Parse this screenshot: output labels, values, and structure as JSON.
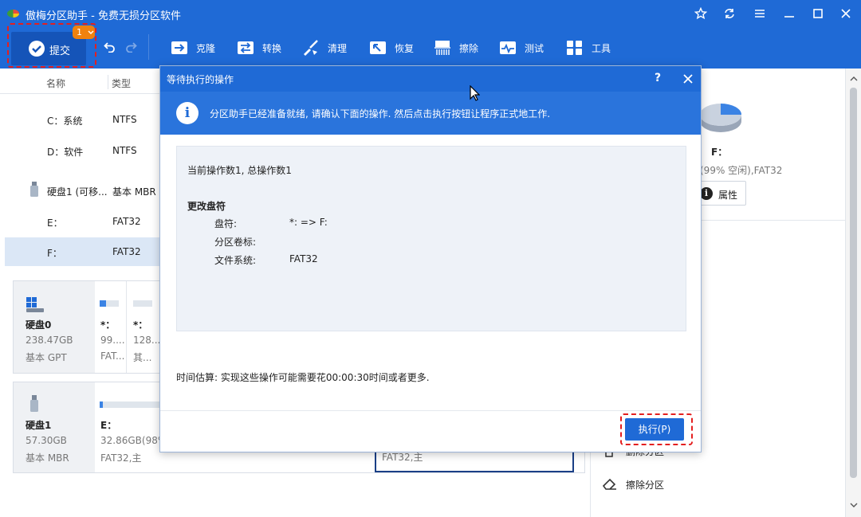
{
  "titlebar": {
    "title": "傲梅分区助手 - 免费无损分区软件"
  },
  "toolbar": {
    "commit_label": "提交",
    "pending_count": "1",
    "items": [
      {
        "label": "克隆",
        "icon": "clone-icon"
      },
      {
        "label": "转换",
        "icon": "convert-icon"
      },
      {
        "label": "清理",
        "icon": "clean-icon"
      },
      {
        "label": "恢复",
        "icon": "restore-icon"
      },
      {
        "label": "擦除",
        "icon": "wipe-icon"
      },
      {
        "label": "测试",
        "icon": "test-icon"
      },
      {
        "label": "工具",
        "icon": "tools-icon"
      }
    ]
  },
  "partition_list": {
    "headers": {
      "name": "名称",
      "type": "类型"
    },
    "rows": [
      {
        "name": "C：系统",
        "type": "NTFS"
      },
      {
        "name": "D：软件",
        "type": "NTFS"
      },
      {
        "name": "硬盘1 (可移...",
        "type": "基本 MBR"
      },
      {
        "name": "E：",
        "type": "FAT32"
      },
      {
        "name": "F：",
        "type": "FAT32"
      }
    ]
  },
  "disks": [
    {
      "name": "硬盘0",
      "size": "238.47GB",
      "kind": "基本 GPT",
      "parts": [
        {
          "letter": "*：",
          "size": "99....",
          "fs": "FAT..."
        },
        {
          "letter": "*：",
          "size": "128...",
          "fs": "其..."
        }
      ]
    },
    {
      "name": "硬盘1",
      "size": "57.30GB",
      "kind": "基本 MBR",
      "parts": [
        {
          "letter": "E：",
          "size": "32.86GB(98%",
          "fs": "FAT32,主"
        },
        {
          "letter": "",
          "size": "",
          "fs": "FAT32,主"
        }
      ]
    }
  ],
  "right_panel": {
    "drive": "F：",
    "free_info": "(99% 空闲),FAT32",
    "attr_label": "属性",
    "op1": "删除分区",
    "op2": "擦除分区"
  },
  "dialog": {
    "title": "等待执行的操作",
    "help": "?",
    "info": "分区助手已经准备就绪, 请确认下面的操作. 然后点击执行按钮让程序正式地工作.",
    "count_line": "当前操作数1, 总操作数1",
    "op_title": "更改盘符",
    "details": [
      {
        "label": "盘符:",
        "value": "*: => F:"
      },
      {
        "label": "分区卷标:",
        "value": ""
      },
      {
        "label": "文件系统:",
        "value": "FAT32"
      }
    ],
    "estimate": "时间估算: 实现这些操作可能需要花00:00:30时间或者更多.",
    "execute": "执行(P)"
  }
}
